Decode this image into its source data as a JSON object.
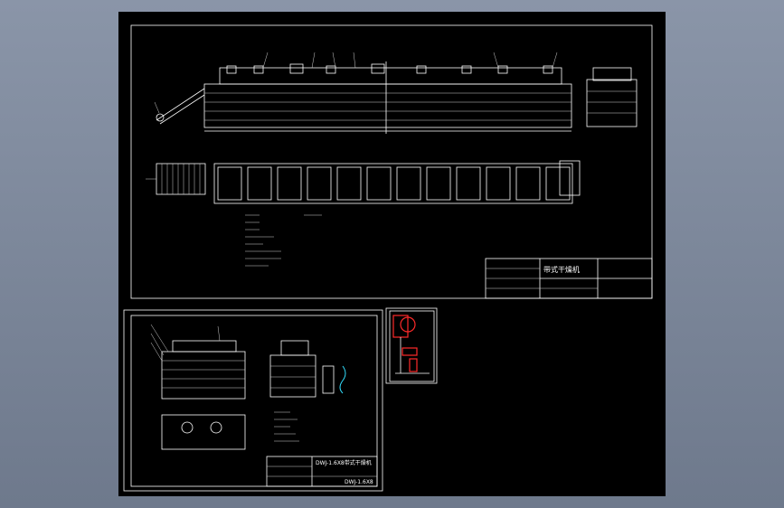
{
  "main_sheet": {
    "title_block": {
      "name": "带式干燥机"
    }
  },
  "sub_sheet": {
    "title_block": {
      "name": "DWJ-1.6X8带式干燥机",
      "code": "DWJ-1.6X8"
    }
  },
  "colors": {
    "background": "#000000",
    "linework": "#ffffff",
    "highlight": "#ff2a2a",
    "accent": "#33e0ff",
    "viewport": "#7f8b9e"
  }
}
